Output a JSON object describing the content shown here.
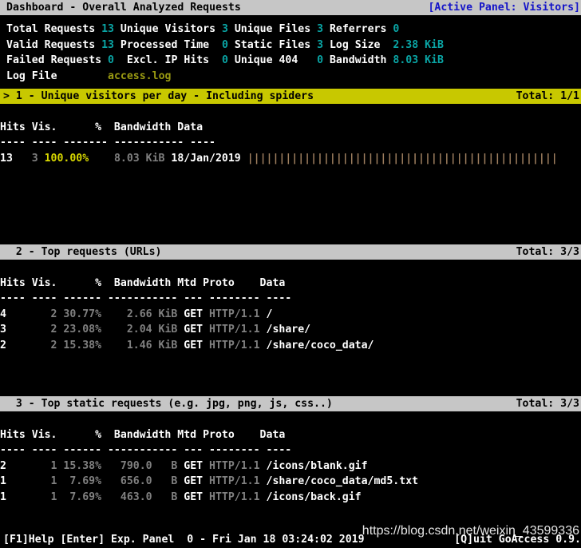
{
  "titlebar": {
    "title": "Dashboard - Overall Analyzed Requests",
    "active_panel": "[Active Panel: Visitors]"
  },
  "overall": {
    "rows": [
      {
        "cells": [
          {
            "label": "Total Requests ",
            "value": "13"
          },
          {
            "label": " Unique Visitors ",
            "value": "3"
          },
          {
            "label": " Unique Files ",
            "value": "3"
          },
          {
            "label": " Referrers ",
            "value": "0"
          }
        ]
      },
      {
        "cells": [
          {
            "label": "Valid Requests ",
            "value": "13"
          },
          {
            "label": " Processed Time  ",
            "value": "0"
          },
          {
            "label": " Static Files ",
            "value": "3"
          },
          {
            "label": " Log Size  ",
            "value": "2.38 KiB"
          }
        ]
      },
      {
        "cells": [
          {
            "label": "Failed Requests ",
            "value": "0"
          },
          {
            "label": "  Excl. IP Hits  ",
            "value": "0"
          },
          {
            "label": " Unique 404   ",
            "value": "0"
          },
          {
            "label": " Bandwidth ",
            "value": "8.03 KiB"
          }
        ]
      }
    ],
    "logfile_label": "Log File",
    "logfile_value": "access.log"
  },
  "panels": [
    {
      "id": "visitors",
      "active": true,
      "marker": "> ",
      "number": "1",
      "title": "1 - Unique visitors per day - Including spiders",
      "total": "Total: 1/1",
      "columns": "Hits Vis.      %  Bandwidth Data",
      "separator": "---- ---- ------- ----------- ----",
      "rows": [
        {
          "hits": "13",
          "vis": "   3",
          "pct": " 100.00%",
          "pct_is_max": true,
          "bandwidth": "    8.03 KiB",
          "mtd": "",
          "proto": "",
          "data": " 18/Jan/2019",
          "bar": " |||||||||||||||||||||||||||||||||||||||||||||||||"
        }
      ]
    },
    {
      "id": "requests",
      "active": false,
      "marker": "  ",
      "number": "2",
      "title": "2 - Top requests (URLs)",
      "total": "Total: 3/3",
      "columns": "Hits Vis.      %  Bandwidth Mtd Proto    Data",
      "separator": "---- ---- ------ ----------- --- -------- ----",
      "rows": [
        {
          "hits": "4",
          "vis": "       2",
          "pct": " 30.77%",
          "pct_is_max": false,
          "bandwidth": "    2.66 KiB",
          "mtd": " GET",
          "proto": " HTTP/1.1",
          "data": " /",
          "bar": ""
        },
        {
          "hits": "3",
          "vis": "       2",
          "pct": " 23.08%",
          "pct_is_max": false,
          "bandwidth": "    2.04 KiB",
          "mtd": " GET",
          "proto": " HTTP/1.1",
          "data": " /share/",
          "bar": ""
        },
        {
          "hits": "2",
          "vis": "       2",
          "pct": " 15.38%",
          "pct_is_max": false,
          "bandwidth": "    1.46 KiB",
          "mtd": " GET",
          "proto": " HTTP/1.1",
          "data": " /share/coco_data/",
          "bar": ""
        }
      ]
    },
    {
      "id": "static-requests",
      "active": false,
      "marker": "  ",
      "number": "3",
      "title": "3 - Top static requests (e.g. jpg, png, js, css..)",
      "total": "Total: 3/3",
      "columns": "Hits Vis.      %  Bandwidth Mtd Proto    Data",
      "separator": "---- ---- ------ ----------- --- -------- ----",
      "rows": [
        {
          "hits": "2",
          "vis": "       1",
          "pct": " 15.38%",
          "pct_is_max": false,
          "bandwidth": "   790.0   B",
          "mtd": " GET",
          "proto": " HTTP/1.1",
          "data": " /icons/blank.gif",
          "bar": ""
        },
        {
          "hits": "1",
          "vis": "       1",
          "pct": "  7.69%",
          "pct_is_max": false,
          "bandwidth": "   656.0   B",
          "mtd": " GET",
          "proto": " HTTP/1.1",
          "data": " /share/coco_data/md5.txt",
          "bar": ""
        },
        {
          "hits": "1",
          "vis": "       1",
          "pct": "  7.69%",
          "pct_is_max": false,
          "bandwidth": "   463.0   B",
          "mtd": " GET",
          "proto": " HTTP/1.1",
          "data": " /icons/back.gif",
          "bar": ""
        }
      ]
    }
  ],
  "footer": {
    "left": "[F1]Help [Enter] Exp. Panel  0 - Fri Jan 18 03:24:02 2019",
    "right": "[Q]uit GoAccess 0.9."
  },
  "watermark": "https://blog.csdn.net/weixin_43599336"
}
